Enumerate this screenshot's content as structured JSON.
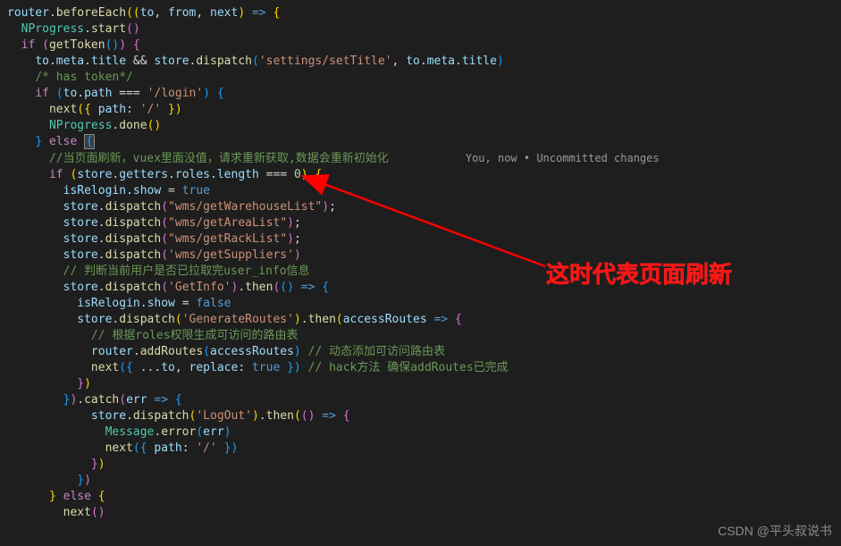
{
  "lens": "You, now • Uncommitted changes",
  "annotation_text": "这时代表页面刷新",
  "watermark": "CSDN @平头叔说书",
  "code": {
    "l1_a": "router",
    "l1_b": "beforeEach",
    "l1_c": "to",
    "l1_d": "from",
    "l1_e": "next",
    "l2_a": "NProgress",
    "l2_b": "start",
    "l3_a": "if",
    "l3_b": "getToken",
    "l4_a": "to",
    "l4_b": "meta",
    "l4_c": "title",
    "l4_d": "store",
    "l4_e": "dispatch",
    "l4_s": "'settings/setTitle'",
    "l4_f": "to",
    "l4_g": "meta",
    "l4_h": "title",
    "l5": "/* has token*/",
    "l6_a": "if",
    "l6_b": "to",
    "l6_c": "path",
    "l6_s": "'/login'",
    "l7_a": "next",
    "l7_b": "path",
    "l7_s": "'/'",
    "l8_a": "NProgress",
    "l8_b": "done",
    "l9_a": "else",
    "l10": "//当页面刷新，vuex里面没值，请求重新获取,数据会重新初始化",
    "l11_a": "if",
    "l11_b": "store",
    "l11_c": "getters",
    "l11_d": "roles",
    "l11_e": "length",
    "l11_n": "0",
    "l12_a": "isRelogin",
    "l12_b": "show",
    "l12_c": "true",
    "l13_a": "store",
    "l13_b": "dispatch",
    "l13_s": "\"wms/getWarehouseList\"",
    "l14_a": "store",
    "l14_b": "dispatch",
    "l14_s": "\"wms/getAreaList\"",
    "l15_a": "store",
    "l15_b": "dispatch",
    "l15_s": "\"wms/getRackList\"",
    "l16_a": "store",
    "l16_b": "dispatch",
    "l16_s": "'wms/getSuppliers'",
    "l17": "// 判断当前用户是否已拉取完user_info信息",
    "l18_a": "store",
    "l18_b": "dispatch",
    "l18_s": "'GetInfo'",
    "l18_c": "then",
    "l19_a": "isRelogin",
    "l19_b": "show",
    "l19_c": "false",
    "l20_a": "store",
    "l20_b": "dispatch",
    "l20_s": "'GenerateRoutes'",
    "l20_c": "then",
    "l20_d": "accessRoutes",
    "l21": "// 根据roles权限生成可访问的路由表",
    "l22_a": "router",
    "l22_b": "addRoutes",
    "l22_c": "accessRoutes",
    "l22_cm": "// 动态添加可访问路由表",
    "l23_a": "next",
    "l23_b": "to",
    "l23_c": "replace",
    "l23_d": "true",
    "l23_cm": "// hack方法 确保addRoutes已完成",
    "l24_a": "catch",
    "l24_b": "err",
    "l25_a": "store",
    "l25_b": "dispatch",
    "l25_s": "'LogOut'",
    "l25_c": "then",
    "l26_a": "Message",
    "l26_b": "error",
    "l26_c": "err",
    "l27_a": "next",
    "l27_b": "path",
    "l27_s": "'/'",
    "l28_a": "else",
    "l29_a": "next"
  }
}
